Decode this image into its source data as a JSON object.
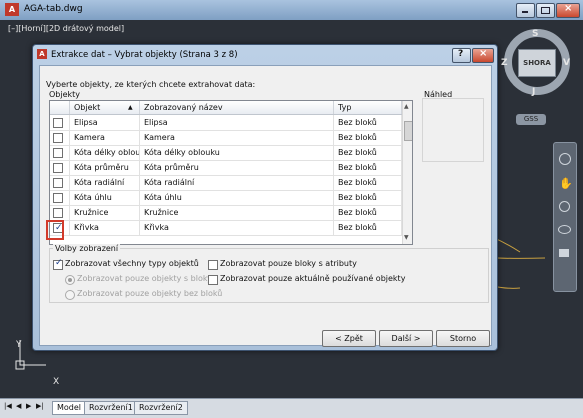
{
  "window": {
    "title": "AGA-tab.dwg"
  },
  "viewport_label": "[–][Horní][2D drátový model]",
  "viewcube": {
    "top": "S",
    "bottom": "J",
    "left": "Z",
    "right": "V",
    "face": "SHORA",
    "ucs": "GSS"
  },
  "dialog": {
    "title": "Extrakce dat – Vybrat objekty (Strana 3 z 8)",
    "instruction": "Vyberte objekty, ze kterých chcete extrahovat data:",
    "objects_label": "Objekty",
    "preview_label": "Náhled",
    "columns": [
      "Objekt",
      "Zobrazovaný název",
      "Typ"
    ],
    "rows": [
      {
        "object": "Elipsa",
        "display": "Elipsa",
        "type": "Bez bloků",
        "checked": false
      },
      {
        "object": "Kamera",
        "display": "Kamera",
        "type": "Bez bloků",
        "checked": false
      },
      {
        "object": "Kóta délky oblouku",
        "display": "Kóta délky oblouku",
        "type": "Bez bloků",
        "checked": false
      },
      {
        "object": "Kóta průměru",
        "display": "Kóta průměru",
        "type": "Bez bloků",
        "checked": false
      },
      {
        "object": "Kóta radiální",
        "display": "Kóta radiální",
        "type": "Bez bloků",
        "checked": false
      },
      {
        "object": "Kóta úhlu",
        "display": "Kóta úhlu",
        "type": "Bez bloků",
        "checked": false
      },
      {
        "object": "Kružnice",
        "display": "Kružnice",
        "type": "Bez bloků",
        "checked": false
      },
      {
        "object": "Křivka",
        "display": "Křivka",
        "type": "Bez bloků",
        "checked": true
      }
    ],
    "display_options_label": "Volby zobrazení",
    "opt_show_all": "Zobrazovat všechny typy objektů",
    "opt_only_blocks": "Zobrazovat pouze objekty s bloky",
    "opt_no_blocks": "Zobrazovat pouze objekty bez bloků",
    "opt_blocks_attr": "Zobrazovat pouze bloky s atributy",
    "opt_current_used": "Zobrazovat pouze aktuálně používané objekty",
    "btn_back": "< Zpět",
    "btn_next": "Další >",
    "btn_cancel": "Storno"
  },
  "tabs": [
    "Model",
    "Rozvržení1",
    "Rozvržení2"
  ],
  "axis": {
    "y": "Y",
    "x": "X"
  }
}
